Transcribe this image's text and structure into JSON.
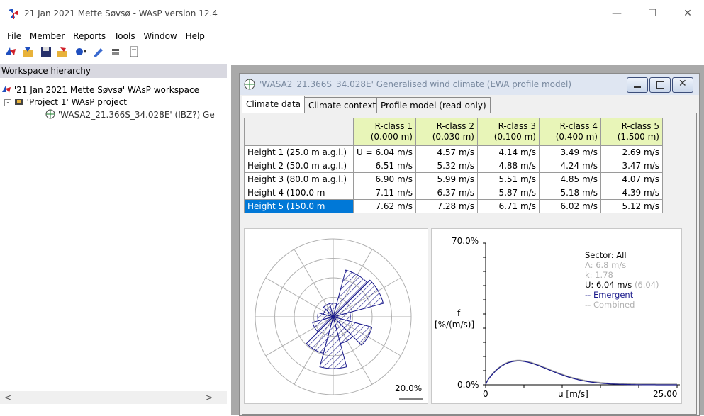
{
  "window": {
    "title": "21 Jan 2021 Mette Søvsø - WAsP version 12.4",
    "min_glyph": "—",
    "max_glyph": "☐",
    "close_glyph": "✕"
  },
  "menu": [
    {
      "label": "File"
    },
    {
      "label": "Member"
    },
    {
      "label": "Reports"
    },
    {
      "label": "Tools"
    },
    {
      "label": "Window"
    },
    {
      "label": "Help"
    }
  ],
  "toolbar_icons": [
    "new-workspace-icon",
    "open-workspace-icon",
    "save-icon",
    "insert-member-icon",
    "add-item-icon",
    "edit-icon",
    "tool-icon",
    "document-icon"
  ],
  "workspace": {
    "header": "Workspace hierarchy",
    "root": "'21 Jan 2021 Mette Søvsø' WAsP workspace",
    "project": "'Project 1' WAsP project",
    "climate": "'WASA2_21.366S_34.028E' (IBZ?) Ge"
  },
  "child": {
    "title": "'WASA2_21.366S_34.028E' Generalised wind climate (EWA profile model)",
    "tabs": [
      {
        "label": "Climate data",
        "active": true
      },
      {
        "label": "Climate context",
        "active": false
      },
      {
        "label": "Profile model (read-only)",
        "active": false
      }
    ]
  },
  "grid": {
    "columns": [
      {
        "line1": "R-class 1",
        "line2": "(0.000 m)"
      },
      {
        "line1": "R-class 2",
        "line2": "(0.030 m)"
      },
      {
        "line1": "R-class 3",
        "line2": "(0.100 m)"
      },
      {
        "line1": "R-class 4",
        "line2": "(0.400 m)"
      },
      {
        "line1": "R-class 5",
        "line2": "(1.500 m)"
      }
    ],
    "rows": [
      {
        "label": "Height 1  (25.0 m a.g.l.)",
        "values": [
          "U = 6.04 m/s",
          "4.57 m/s",
          "4.14 m/s",
          "3.49 m/s",
          "2.69 m/s"
        ]
      },
      {
        "label": "Height 2  (50.0 m a.g.l.)",
        "values": [
          "6.51 m/s",
          "5.32 m/s",
          "4.88 m/s",
          "4.24 m/s",
          "3.47 m/s"
        ]
      },
      {
        "label": "Height 3  (80.0 m a.g.l.)",
        "values": [
          "6.90 m/s",
          "5.99 m/s",
          "5.51 m/s",
          "4.85 m/s",
          "4.07 m/s"
        ]
      },
      {
        "label": "Height 4  (100.0 m",
        "values": [
          "7.11 m/s",
          "6.37 m/s",
          "5.87 m/s",
          "5.18 m/s",
          "4.39 m/s"
        ]
      },
      {
        "label": "Height 5  (150.0 m",
        "values": [
          "7.62 m/s",
          "7.28 m/s",
          "6.71 m/s",
          "6.02 m/s",
          "5.12 m/s"
        ],
        "selected": true
      }
    ]
  },
  "rose": {
    "scale_label": "20.0%",
    "sector_frequencies": [
      3.5,
      12.4,
      13.3,
      4.4,
      10.3,
      7.1,
      13.3,
      9.7,
      5.5,
      4.0,
      2.6,
      3.5
    ]
  },
  "chart_data": {
    "type": "line",
    "ylabel_top": "f",
    "ylabel_bottom": "[%/(m/s)]",
    "xlabel": "u [m/s]",
    "x_ticks": [
      "0",
      "25.00"
    ],
    "y_ticks": [
      "0.0%",
      "70.0%"
    ],
    "xlim": [
      0,
      25
    ],
    "ylim": [
      0,
      70
    ],
    "legend": {
      "sector": "Sector: All",
      "A": "A: 6.8 m/s",
      "k": "k: 1.78",
      "U": "U: 6.04 m/s",
      "U_combined": "(6.04)",
      "emergent": "-- Emergent",
      "combined": "-- Combined"
    },
    "series": [
      {
        "name": "Emergent",
        "A": 6.8,
        "k": 1.78,
        "color": "#1a1a8c"
      },
      {
        "name": "Combined",
        "A": 6.8,
        "k": 1.78,
        "color": "#a0a0a0"
      }
    ]
  }
}
